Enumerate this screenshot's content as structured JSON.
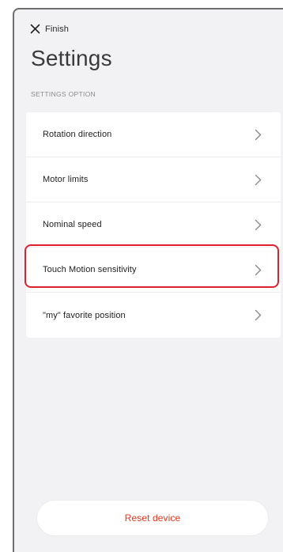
{
  "header": {
    "close_icon": "close-icon",
    "finish_label": "Finish",
    "title": "Settings"
  },
  "section": {
    "title": "SETTINGS OPTION"
  },
  "settings": {
    "items": [
      {
        "label": "Rotation direction",
        "icon": "chevron-right-icon"
      },
      {
        "label": "Motor limits",
        "icon": "chevron-right-icon"
      },
      {
        "label": "Nominal speed",
        "icon": "chevron-right-icon"
      },
      {
        "label": "Touch Motion sensitivity",
        "icon": "chevron-right-icon",
        "highlighted": true
      },
      {
        "label": "\"my\" favorite position",
        "icon": "chevron-right-icon"
      }
    ]
  },
  "footer": {
    "reset_label": "Reset device"
  },
  "colors": {
    "background": "#f2f2f4",
    "card": "#ffffff",
    "highlight": "#e01f2c",
    "reset_text": "#e8341c",
    "chevron": "#8a8a8e"
  }
}
